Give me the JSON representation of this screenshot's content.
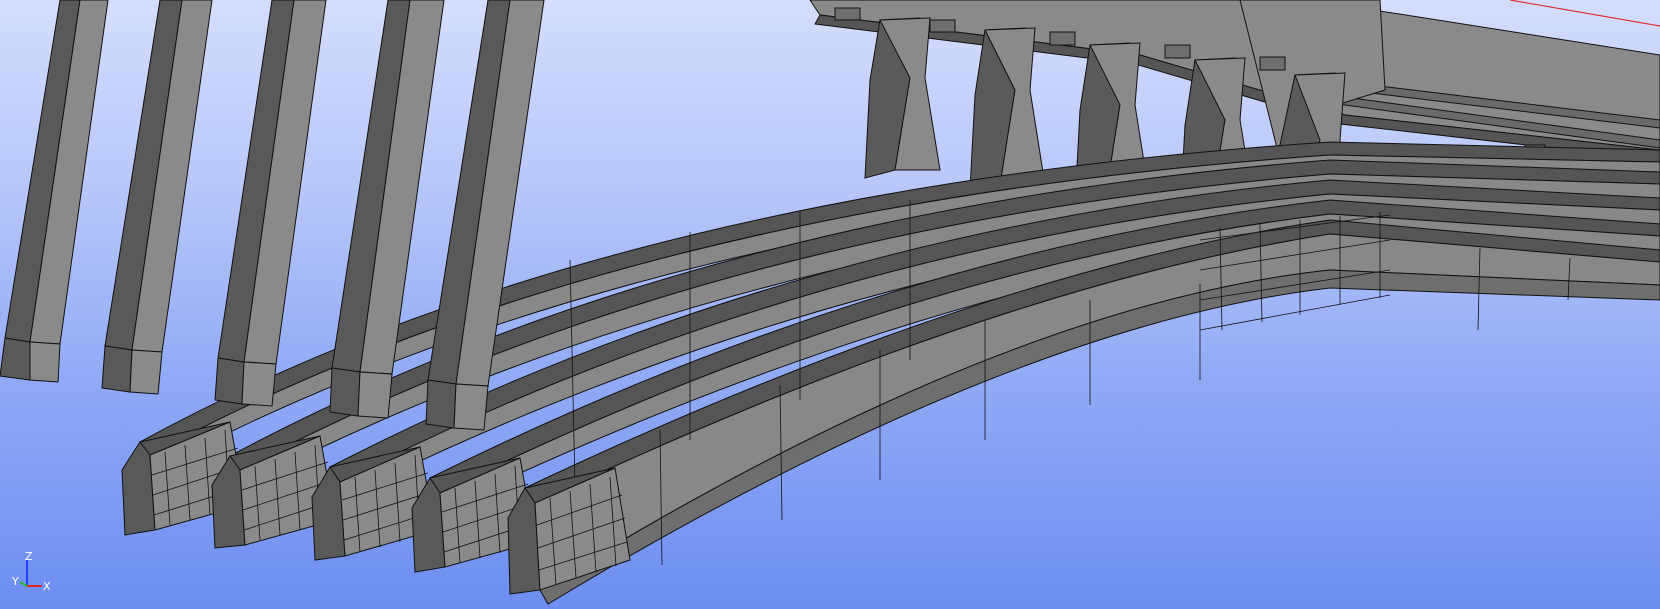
{
  "viewport": {
    "colors": {
      "background_top": "#d4ddfc",
      "background_bottom": "#6d8ef1",
      "mesh_face": "#808080",
      "mesh_face_light": "#8f8f8f",
      "mesh_face_dark": "#595959",
      "mesh_edge": "#111111",
      "reference_line": "#e03030"
    }
  },
  "triad": {
    "z_label": "Z",
    "y_label": "Y",
    "x_label": "X",
    "x_color": "#e02020",
    "y_color": "#20c020",
    "z_color": "#2040ff"
  }
}
